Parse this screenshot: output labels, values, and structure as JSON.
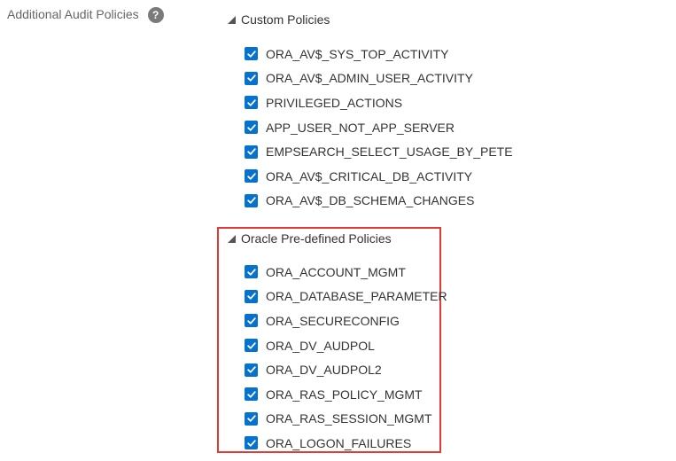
{
  "field": {
    "label": "Additional Audit Policies",
    "help_icon": "?"
  },
  "groups": {
    "custom": {
      "title": "Custom Policies",
      "items": [
        {
          "label": "ORA_AV$_SYS_TOP_ACTIVITY",
          "checked": true
        },
        {
          "label": "ORA_AV$_ADMIN_USER_ACTIVITY",
          "checked": true
        },
        {
          "label": "PRIVILEGED_ACTIONS",
          "checked": true
        },
        {
          "label": "APP_USER_NOT_APP_SERVER",
          "checked": true
        },
        {
          "label": "EMPSEARCH_SELECT_USAGE_BY_PETE",
          "checked": true
        },
        {
          "label": "ORA_AV$_CRITICAL_DB_ACTIVITY",
          "checked": true
        },
        {
          "label": "ORA_AV$_DB_SCHEMA_CHANGES",
          "checked": true
        }
      ]
    },
    "oracle": {
      "title": "Oracle Pre-defined Policies",
      "items": [
        {
          "label": "ORA_ACCOUNT_MGMT",
          "checked": true
        },
        {
          "label": "ORA_DATABASE_PARAMETER",
          "checked": true
        },
        {
          "label": "ORA_SECURECONFIG",
          "checked": true
        },
        {
          "label": "ORA_DV_AUDPOL",
          "checked": true
        },
        {
          "label": "ORA_DV_AUDPOL2",
          "checked": true
        },
        {
          "label": "ORA_RAS_POLICY_MGMT",
          "checked": true
        },
        {
          "label": "ORA_RAS_SESSION_MGMT",
          "checked": true
        },
        {
          "label": "ORA_LOGON_FAILURES",
          "checked": true
        }
      ]
    }
  },
  "icons": {
    "help": "help-icon",
    "collapse": "triangle-down-icon",
    "check": "checkmark-icon"
  },
  "colors": {
    "checkbox": "#0572ce",
    "highlight": "#e53935",
    "label": "#666666",
    "text": "#333333"
  }
}
